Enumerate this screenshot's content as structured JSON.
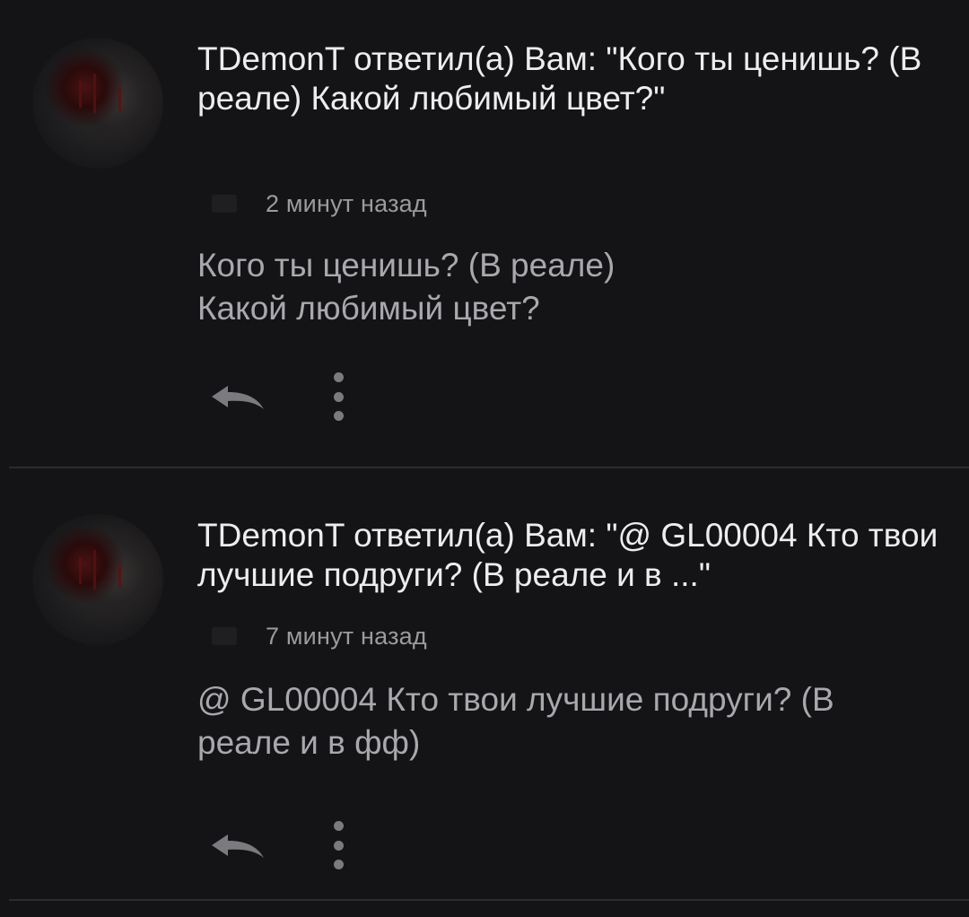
{
  "notifications": [
    {
      "user": "TDemonT",
      "action": "ответил(а) Вам:",
      "quote": "\"Кого ты ценишь? (В реале) Какой любимый цвет?\"",
      "time": "2 минут назад",
      "body_lines": [
        "Кого ты ценишь? (В реале)",
        "Какой любимый цвет?"
      ],
      "reply_icon": "reply-arrow",
      "more_icon": "vertical-dots"
    },
    {
      "user": "TDemonT",
      "action": "ответил(а) Вам:",
      "quote": "\"@ GL00004 Кто твои лучшие подруги? (В реале и в ...\"",
      "time": "7 минут назад",
      "body_lines": [
        "@ GL00004  Кто твои лучшие подруги? (В",
        "реале и в фф)"
      ],
      "reply_icon": "reply-arrow",
      "more_icon": "vertical-dots"
    }
  ],
  "colors": {
    "background": "#141316",
    "title_text": "#ededf0",
    "body_text": "#a9a8ad",
    "meta_text": "#9b9b9f",
    "icon": "#7b7a7f",
    "divider": "#2c2b2f"
  }
}
